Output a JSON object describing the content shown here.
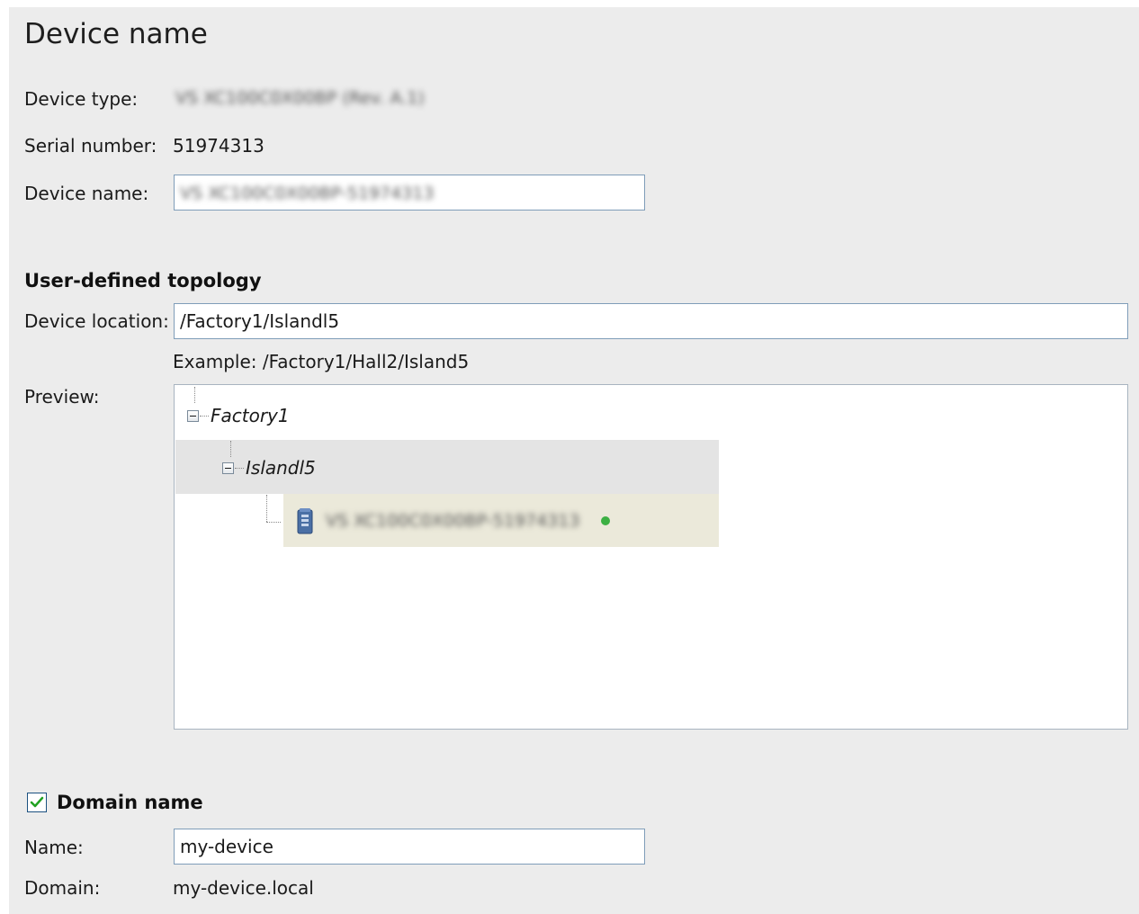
{
  "header": {
    "title": "Device name"
  },
  "device": {
    "type_label": "Device type:",
    "type_value": "VS XC100C0X00BP (Rev. A.1)",
    "serial_label": "Serial number:",
    "serial_value": "51974313",
    "name_label": "Device name:",
    "name_value": "VS XC100C0X00BP-51974313"
  },
  "topology": {
    "section_title": "User-defined topology",
    "location_label": "Device location:",
    "location_value": "/Factory1/Islandl5",
    "example_text": "Example: /Factory1/Hall2/Island5",
    "preview_label": "Preview:",
    "tree": {
      "root": "Factory1",
      "child": "Islandl5",
      "leaf": "VS XC100C0X00BP-51974313",
      "leaf_icon": "device-icon",
      "status_color": "#3cb043"
    }
  },
  "domain": {
    "checkbox_checked": true,
    "section_title": "Domain name",
    "name_label": "Name:",
    "name_value": "my-device",
    "domain_label": "Domain:",
    "domain_value": "my-device.local"
  }
}
